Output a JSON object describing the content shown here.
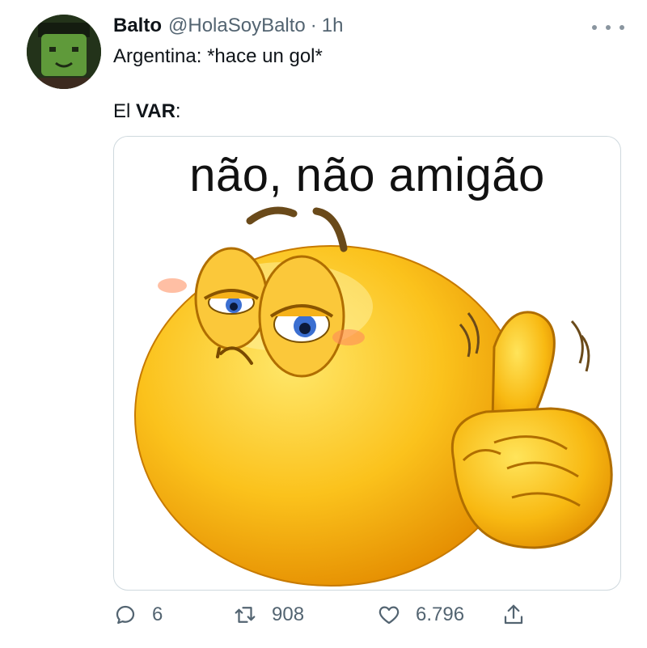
{
  "tweet": {
    "author_name": "Balto",
    "author_handle": "@HolaSoyBalto",
    "separator": "·",
    "time": "1h",
    "text_line1": "Argentina: *hace un gol*",
    "text_line2_prefix": "El ",
    "text_line2_bold": "VAR",
    "text_line2_suffix": ":"
  },
  "media": {
    "caption": "não, não amigão"
  },
  "actions": {
    "reply_icon": "reply-icon",
    "reply_count": "6",
    "retweet_icon": "retweet-icon",
    "retweet_count": "908",
    "like_icon": "heart-icon",
    "like_count": "6.796",
    "share_icon": "share-icon"
  },
  "colors": {
    "text": "#0f1419",
    "secondary": "#536471",
    "border": "#cfd9de",
    "emoji_yellow": "#f7b500"
  }
}
